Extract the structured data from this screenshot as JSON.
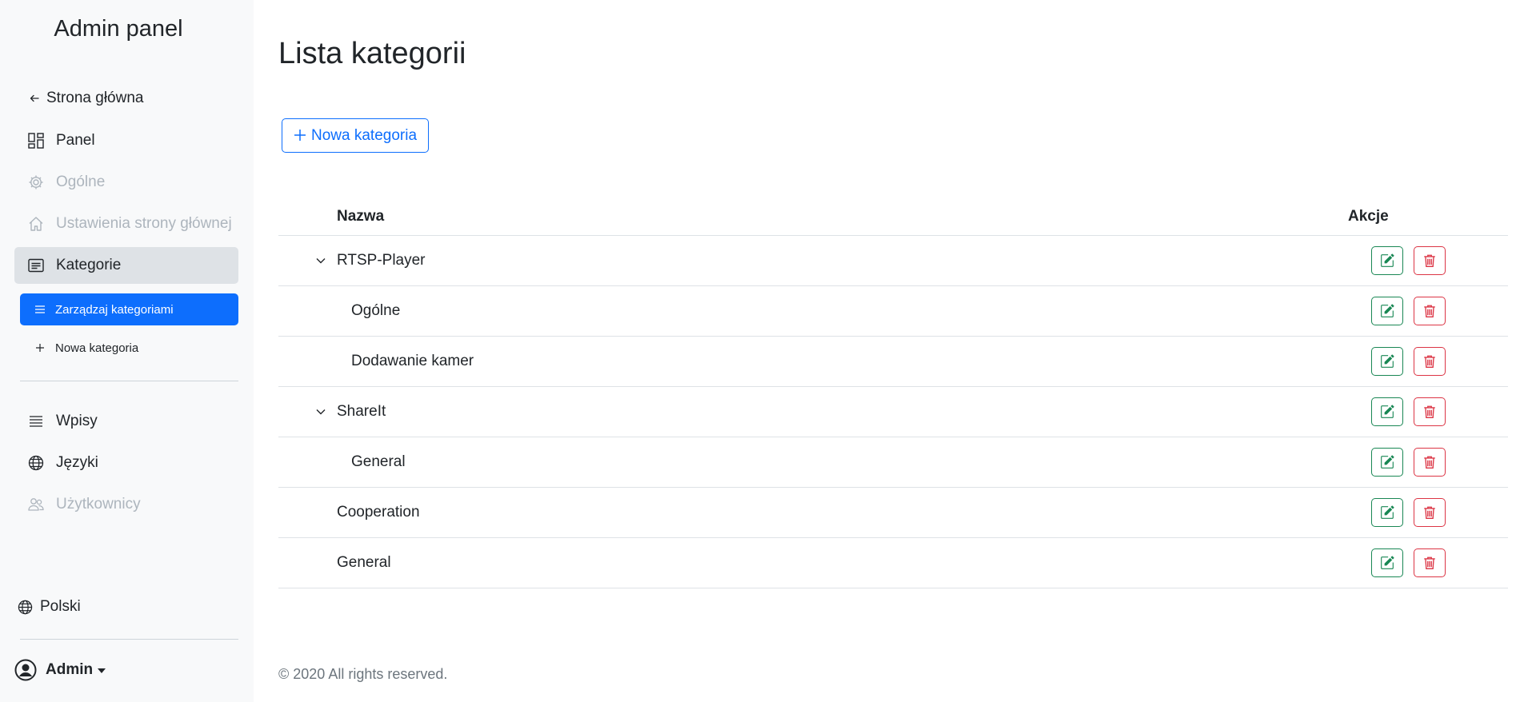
{
  "sidebar": {
    "brand": "Admin panel",
    "back_label": "Strona główna",
    "items": [
      {
        "label": "Panel"
      },
      {
        "label": "Ogólne"
      },
      {
        "label": "Ustawienia strony głównej"
      },
      {
        "label": "Kategorie"
      }
    ],
    "sub_items": [
      {
        "label": "Zarządzaj kategoriami"
      },
      {
        "label": "Nowa kategoria"
      }
    ],
    "items2": [
      {
        "label": "Wpisy"
      },
      {
        "label": "Języki"
      },
      {
        "label": "Użytkownicy"
      }
    ],
    "language": "Polski",
    "user": "Admin"
  },
  "main": {
    "title": "Lista kategorii",
    "new_button": "Nowa kategoria",
    "table": {
      "col_name": "Nazwa",
      "col_actions": "Akcje",
      "rows": [
        {
          "name": "RTSP-Player"
        },
        {
          "name": "Ogólne"
        },
        {
          "name": "Dodawanie kamer"
        },
        {
          "name": "ShareIt"
        },
        {
          "name": "General"
        },
        {
          "name": "Cooperation"
        },
        {
          "name": "General"
        }
      ]
    },
    "footer": "© 2020 All rights reserved."
  },
  "colors": {
    "primary": "#0d6efd",
    "success": "#198754",
    "danger": "#dc3545",
    "muted": "#adb5bd",
    "sidebar_bg": "#f8f9fa",
    "active_bg": "#dee2e6"
  }
}
